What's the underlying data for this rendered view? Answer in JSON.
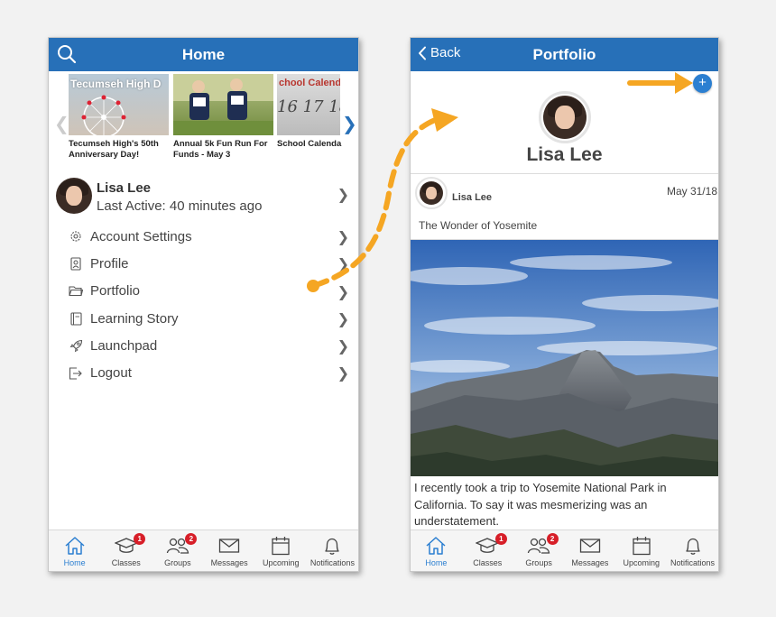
{
  "left_screen": {
    "title": "Home",
    "news": [
      {
        "caption": "Tecumseh High's 50th Anniversary Day!",
        "thumb_text": "Tecumseh High D"
      },
      {
        "caption": "Annual 5k Fun Run For Funds - May 3",
        "thumb_text": ""
      },
      {
        "caption": "School Calenda",
        "thumb_text": "chool Calenda",
        "thumb_nums": "16 17 18"
      }
    ],
    "profile": {
      "name": "Lisa Lee",
      "last_active": "Last Active: 40 minutes ago"
    },
    "menu": [
      {
        "label": "Account Settings",
        "icon": "gear-icon"
      },
      {
        "label": "Profile",
        "icon": "profile-badge-icon"
      },
      {
        "label": "Portfolio",
        "icon": "folder-icon"
      },
      {
        "label": "Learning Story",
        "icon": "book-icon"
      },
      {
        "label": "Launchpad",
        "icon": "rocket-icon"
      },
      {
        "label": "Logout",
        "icon": "logout-icon"
      }
    ]
  },
  "right_screen": {
    "back_label": "Back",
    "title": "Portfolio",
    "add_label": "+",
    "name": "Lisa Lee",
    "post": {
      "author": "Lisa Lee",
      "date": "May 31/18",
      "title": "The Wonder of Yosemite",
      "body": "I recently took a trip to Yosemite National Park in California. To say it was mesmerizing was an understatement."
    }
  },
  "tabbar": [
    {
      "label": "Home",
      "icon": "home-icon",
      "badge": "",
      "active": true
    },
    {
      "label": "Classes",
      "icon": "graduation-cap-icon",
      "badge": "1"
    },
    {
      "label": "Groups",
      "icon": "people-icon",
      "badge": "2"
    },
    {
      "label": "Messages",
      "icon": "envelope-icon",
      "badge": ""
    },
    {
      "label": "Upcoming",
      "icon": "calendar-icon",
      "badge": ""
    },
    {
      "label": "Notifications",
      "icon": "bell-icon",
      "badge": ""
    }
  ],
  "colors": {
    "header": "#2770b8",
    "active_tab": "#2b7fd1",
    "badge": "#d71e28",
    "annotation_arrow": "#f5a623"
  }
}
